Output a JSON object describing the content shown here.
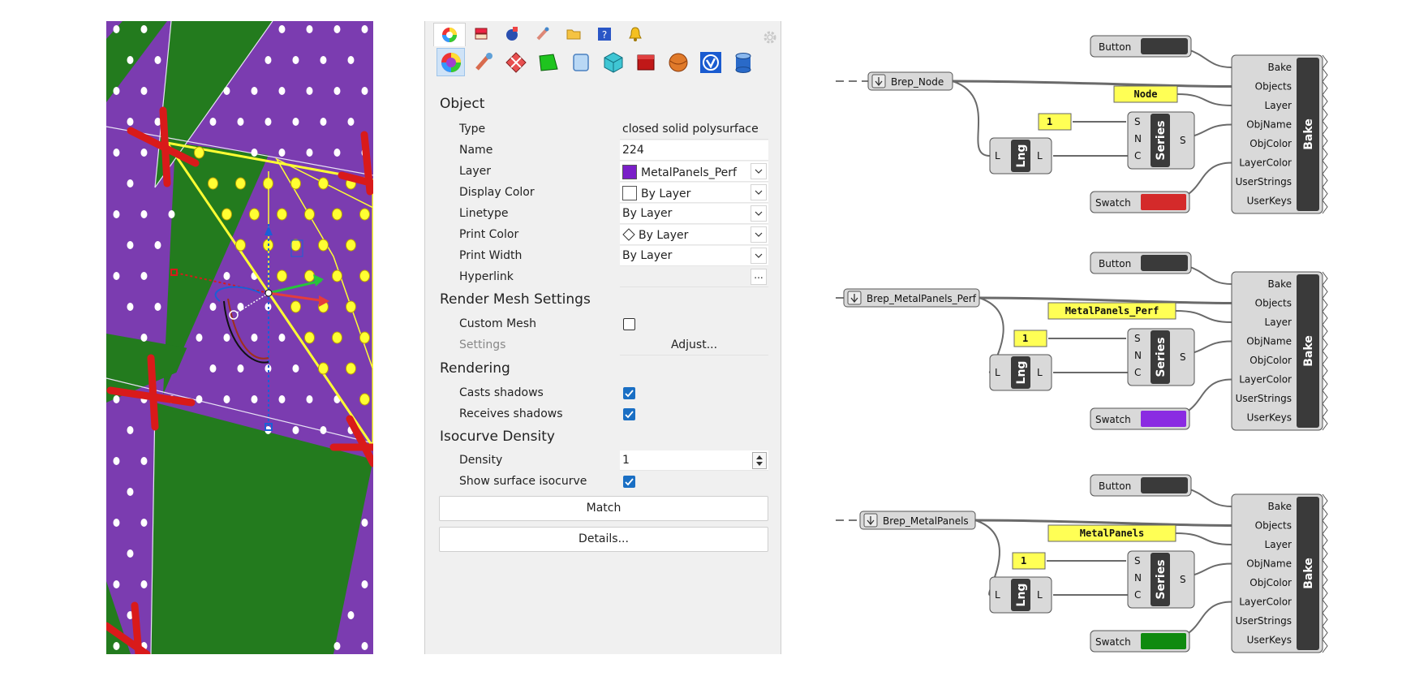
{
  "viewport": {
    "colors": {
      "panel_purple": "#7b3cb0",
      "panel_green": "#237b1e",
      "selection": "#ffff33",
      "marker_red": "#d91a1a"
    }
  },
  "panel": {
    "tabs": [
      {
        "icon": "color-wheel-icon"
      },
      {
        "icon": "layers-icon"
      },
      {
        "icon": "material-icon"
      },
      {
        "icon": "brush-icon"
      },
      {
        "icon": "folder-icon"
      },
      {
        "icon": "help-icon"
      },
      {
        "icon": "bell-icon"
      }
    ],
    "big_icons": [
      {
        "icon": "object-color-icon"
      },
      {
        "icon": "wrench-icon"
      },
      {
        "icon": "texture-mapping-icon"
      },
      {
        "icon": "surface-icon"
      },
      {
        "icon": "glass-icon"
      },
      {
        "icon": "cube-icon"
      },
      {
        "icon": "red-box-icon"
      },
      {
        "icon": "sphere-icon"
      },
      {
        "icon": "v-badge-icon"
      },
      {
        "icon": "cylinder-icon"
      }
    ],
    "object": {
      "heading": "Object",
      "type_label": "Type",
      "type_value": "closed solid polysurface",
      "name_label": "Name",
      "name_value": "224",
      "layer_label": "Layer",
      "layer_value": "MetalPanels_Perf",
      "layer_color": "#7a1fc8",
      "display_color_label": "Display Color",
      "display_color_value": "By Layer",
      "linetype_label": "Linetype",
      "linetype_value": "By Layer",
      "print_color_label": "Print Color",
      "print_color_value": "By Layer",
      "print_width_label": "Print Width",
      "print_width_value": "By Layer",
      "hyperlink_label": "Hyperlink",
      "hyperlink_button": "..."
    },
    "render_mesh": {
      "heading": "Render Mesh Settings",
      "custom_mesh_label": "Custom Mesh",
      "custom_mesh_checked": false,
      "settings_label": "Settings",
      "adjust_label": "Adjust..."
    },
    "rendering": {
      "heading": "Rendering",
      "casts_label": "Casts shadows",
      "casts_checked": true,
      "receives_label": "Receives shadows",
      "receives_checked": true
    },
    "isocurve": {
      "heading": "Isocurve Density",
      "density_label": "Density",
      "density_value": "1",
      "show_label": "Show surface isocurve",
      "show_checked": true
    },
    "match_button": "Match",
    "details_button": "Details..."
  },
  "grasshopper": {
    "groups": [
      {
        "brep_label": "Brep_Node",
        "layer_text": "Node",
        "button_label": "Button",
        "int_value": "1",
        "lng_label": "Lng",
        "series_label": "Series",
        "swatch_label": "Swatch",
        "swatch_color": "#d42a2a",
        "bake_label": "Bake",
        "bake_inputs": [
          "Bake",
          "Objects",
          "Layer",
          "ObjName",
          "ObjColor",
          "LayerColor",
          "UserStrings",
          "UserKeys"
        ],
        "series_inputs": [
          "S",
          "N",
          "C"
        ],
        "series_output": "S",
        "lng_input": "L",
        "lng_output": "L"
      },
      {
        "brep_label": "Brep_MetalPanels_Perf",
        "layer_text": "MetalPanels_Perf",
        "button_label": "Button",
        "int_value": "1",
        "lng_label": "Lng",
        "series_label": "Series",
        "swatch_label": "Swatch",
        "swatch_color": "#8a2be2",
        "bake_label": "Bake",
        "bake_inputs": [
          "Bake",
          "Objects",
          "Layer",
          "ObjName",
          "ObjColor",
          "LayerColor",
          "UserStrings",
          "UserKeys"
        ],
        "series_inputs": [
          "S",
          "N",
          "C"
        ],
        "series_output": "S",
        "lng_input": "L",
        "lng_output": "L"
      },
      {
        "brep_label": "Brep_MetalPanels",
        "layer_text": "MetalPanels",
        "button_label": "Button",
        "int_value": "1",
        "lng_label": "Lng",
        "series_label": "Series",
        "swatch_label": "Swatch",
        "swatch_color": "#0f8a0f",
        "bake_label": "Bake",
        "bake_inputs": [
          "Bake",
          "Objects",
          "Layer",
          "ObjName",
          "ObjColor",
          "LayerColor",
          "UserStrings",
          "UserKeys"
        ],
        "series_inputs": [
          "S",
          "N",
          "C"
        ],
        "series_output": "S",
        "lng_input": "L",
        "lng_output": "L"
      }
    ]
  }
}
